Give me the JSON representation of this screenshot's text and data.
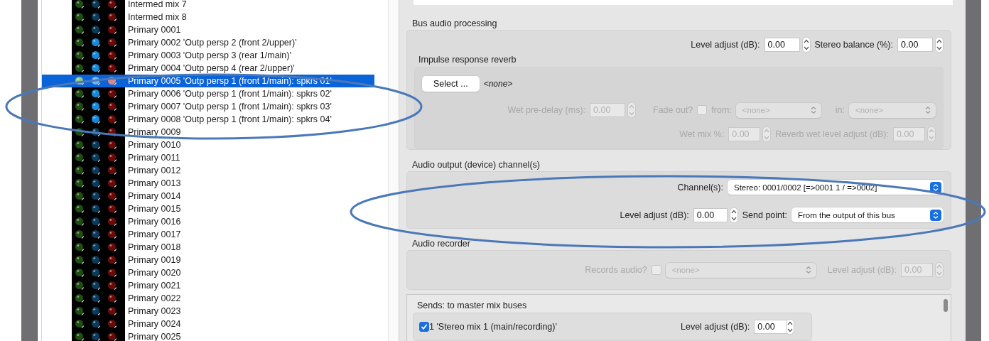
{
  "bus_list": {
    "rows": [
      {
        "label": "Intermed mix 7",
        "selected": false,
        "blue_lit": false
      },
      {
        "label": "Intermed mix 8",
        "selected": false,
        "blue_lit": false
      },
      {
        "label": "Primary 0001",
        "selected": false,
        "blue_lit": false
      },
      {
        "label": "Primary 0002 'Outp persp 2 (front 2/upper)'",
        "selected": false,
        "blue_lit": true
      },
      {
        "label": "Primary 0003 'Outp persp 3 (rear 1/main)'",
        "selected": false,
        "blue_lit": true
      },
      {
        "label": "Primary 0004 'Outp persp 4 (rear 2/upper)'",
        "selected": false,
        "blue_lit": true
      },
      {
        "label": "Primary 0005 'Outp persp 1 (front 1/main): spkrs 01'",
        "selected": true,
        "blue_lit": true
      },
      {
        "label": "Primary 0006 'Outp persp 1 (front 1/main): spkrs 02'",
        "selected": false,
        "blue_lit": true
      },
      {
        "label": "Primary 0007 'Outp persp 1 (front 1/main): spkrs 03'",
        "selected": false,
        "blue_lit": true
      },
      {
        "label": "Primary 0008 'Outp persp 1 (front 1/main): spkrs 04'",
        "selected": false,
        "blue_lit": true
      },
      {
        "label": "Primary 0009",
        "selected": false,
        "blue_lit": false
      },
      {
        "label": "Primary 0010",
        "selected": false,
        "blue_lit": false
      },
      {
        "label": "Primary 0011",
        "selected": false,
        "blue_lit": false
      },
      {
        "label": "Primary 0012",
        "selected": false,
        "blue_lit": false
      },
      {
        "label": "Primary 0013",
        "selected": false,
        "blue_lit": false
      },
      {
        "label": "Primary 0014",
        "selected": false,
        "blue_lit": false
      },
      {
        "label": "Primary 0015",
        "selected": false,
        "blue_lit": false
      },
      {
        "label": "Primary 0016",
        "selected": false,
        "blue_lit": false
      },
      {
        "label": "Primary 0017",
        "selected": false,
        "blue_lit": false
      },
      {
        "label": "Primary 0018",
        "selected": false,
        "blue_lit": false
      },
      {
        "label": "Primary 0019",
        "selected": false,
        "blue_lit": false
      },
      {
        "label": "Primary 0020",
        "selected": false,
        "blue_lit": false
      },
      {
        "label": "Primary 0021",
        "selected": false,
        "blue_lit": false
      },
      {
        "label": "Primary 0022",
        "selected": false,
        "blue_lit": false
      },
      {
        "label": "Primary 0023",
        "selected": false,
        "blue_lit": false
      },
      {
        "label": "Primary 0024",
        "selected": false,
        "blue_lit": false
      },
      {
        "label": "Primary 0025",
        "selected": false,
        "blue_lit": false
      }
    ]
  },
  "bus_audio_processing": {
    "title": "Bus audio processing",
    "level_adjust": {
      "label": "Level adjust (dB):",
      "value": "0.00",
      "disabled": false
    },
    "stereo_balance": {
      "label": "Stereo balance (%):",
      "value": "0.00",
      "disabled": false
    },
    "reverb": {
      "title": "Impulse response reverb",
      "select_button": "Select ...",
      "file": "<none>",
      "wet_predelay": {
        "label": "Wet pre-delay (ms):",
        "value": "0.00",
        "disabled": true
      },
      "fade_out": {
        "label": "Fade out?",
        "checked": false,
        "disabled": true
      },
      "from": {
        "label": "from:",
        "value": "<none>",
        "disabled": true
      },
      "in": {
        "label": "in:",
        "value": "<none>",
        "disabled": true
      },
      "wet_mix": {
        "label": "Wet mix %:",
        "value": "0.00",
        "disabled": true
      },
      "reverb_wet_level": {
        "label": "Reverb wet level adjust (dB):",
        "value": "0.00",
        "disabled": true
      }
    }
  },
  "audio_output": {
    "title": "Audio output (device) channel(s)",
    "channels": {
      "label": "Channel(s):",
      "value": "Stereo: 0001/0002 [=>0001 1 / =>0002]",
      "disabled": false
    },
    "level_adjust": {
      "label": "Level adjust (dB):",
      "value": "0.00",
      "disabled": false
    },
    "send_point": {
      "label": "Send point:",
      "value": "From the output of this bus",
      "disabled": false
    }
  },
  "audio_recorder": {
    "title": "Audio recorder",
    "records_audio": {
      "label": "Records audio?",
      "checked": false,
      "disabled": true
    },
    "source": {
      "value": "<none>",
      "disabled": true
    },
    "level_adjust": {
      "label": "Level adjust (dB):",
      "value": "0.00",
      "disabled": true
    }
  },
  "sends": {
    "title": "Sends: to master mix buses",
    "items": [
      {
        "label": "1 'Stereo mix 1 (main/recording)'",
        "checked": true,
        "level_label": "Level adjust (dB):",
        "level_value": "0.00"
      }
    ]
  }
}
